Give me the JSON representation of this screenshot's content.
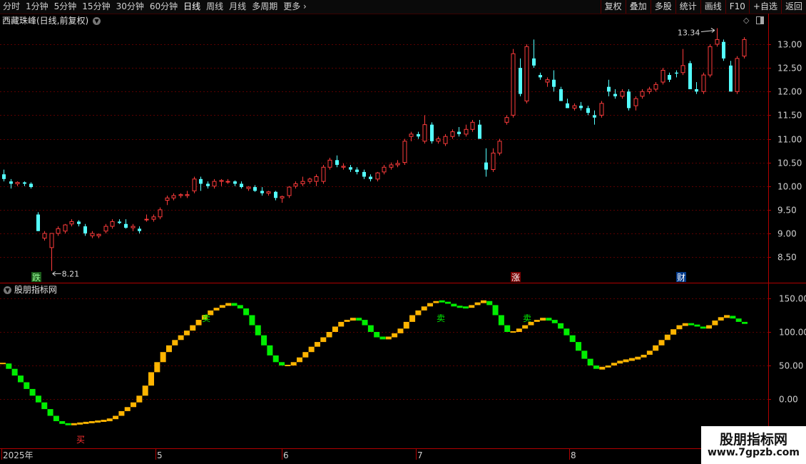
{
  "toolbar": {
    "periods": [
      "分时",
      "1分钟",
      "5分钟",
      "15分钟",
      "30分钟",
      "60分钟",
      "日线",
      "周线",
      "月线",
      "多周期",
      "更多"
    ],
    "active_period": "日线",
    "right_buttons": [
      "复权",
      "叠加",
      "多股",
      "统计",
      "画线",
      "F10",
      "+自选",
      "返回"
    ]
  },
  "main": {
    "title": "西藏珠峰(日线,前复权)",
    "y_ticks": [
      "13.00",
      "12.50",
      "12.00",
      "11.50",
      "11.00",
      "10.50",
      "10.00",
      "9.50",
      "9.00",
      "8.50"
    ],
    "high_label": "13.34",
    "low_label": "8.21",
    "events": [
      "跌",
      "涨",
      "财"
    ]
  },
  "indicator": {
    "title": "股朋指标网",
    "y_ticks": [
      "150.00",
      "100.00",
      "50.00",
      "0.00"
    ],
    "signals": [
      "买",
      "卖",
      "卖",
      "卖"
    ]
  },
  "x_axis": {
    "labels": [
      "2025年",
      "5",
      "6",
      "7",
      "8"
    ]
  },
  "watermark": {
    "title": "股朋指标网",
    "url": "www.7gpzb.com"
  },
  "colors": {
    "up": "#ff3b3b",
    "down": "#54ffff",
    "rise": "#ffb400",
    "fall": "#00ee00",
    "grid": "#5a0000",
    "axis": "#b00000"
  },
  "chart_data": [
    {
      "type": "candlestick",
      "title": "西藏珠峰(日线,前复权)",
      "ylim": [
        8.1,
        13.6
      ],
      "x": [
        1,
        2,
        3,
        4,
        5,
        6,
        7,
        8,
        9,
        10,
        11,
        12,
        13,
        14,
        15,
        16,
        17,
        18,
        19,
        20,
        21,
        22,
        23,
        24,
        25,
        26,
        27,
        28,
        29,
        30,
        31,
        32,
        33,
        34,
        35,
        36,
        37,
        38,
        39,
        40,
        41,
        42,
        43,
        44,
        45,
        46,
        47,
        48,
        49,
        50,
        51,
        52,
        53,
        54,
        55,
        56,
        57,
        58,
        59,
        60,
        61,
        62,
        63,
        64,
        65,
        66,
        67,
        68,
        69,
        70,
        71,
        72,
        73,
        74,
        75,
        76,
        77,
        78,
        79,
        80,
        81,
        82,
        83,
        84,
        85,
        86,
        87,
        88,
        89,
        90,
        91,
        92,
        93,
        94,
        95,
        96,
        97,
        98,
        99,
        100,
        101,
        102,
        103,
        104,
        105,
        106,
        107,
        108,
        109,
        110,
        111,
        112,
        113,
        114,
        115,
        116,
        117,
        118,
        119,
        120,
        121,
        122,
        123,
        124,
        125,
        126,
        127,
        128,
        129,
        130,
        131,
        132,
        133,
        134,
        135,
        136,
        137,
        138,
        139,
        140,
        141,
        142,
        143,
        144,
        145,
        146,
        147,
        148,
        149,
        150,
        151,
        152,
        153,
        154,
        155,
        156,
        157,
        158,
        159,
        160,
        161,
        162,
        163,
        164,
        165,
        166,
        167,
        168,
        169,
        170,
        171,
        172,
        173,
        174,
        175,
        176,
        177,
        178,
        179,
        180,
        181,
        182,
        183,
        184,
        185,
        186,
        187,
        188,
        189,
        190,
        191,
        192,
        193,
        194,
        195,
        196,
        197,
        198,
        199,
        200,
        201,
        202,
        203,
        204,
        205,
        206,
        207,
        208,
        209,
        210,
        211,
        212,
        213,
        214,
        215,
        216,
        217,
        218,
        219,
        220,
        221,
        222,
        223,
        224,
        225,
        226,
        227,
        228,
        229,
        230,
        231,
        232,
        233,
        234,
        235,
        236,
        237,
        238,
        239,
        240,
        241,
        242,
        243,
        244,
        245,
        246,
        247,
        248,
        249,
        250,
        251,
        252,
        253,
        254,
        255,
        256,
        257,
        258,
        259,
        260,
        261,
        262,
        263,
        264,
        265,
        266,
        267,
        268,
        269,
        270,
        271,
        272,
        273,
        274,
        275,
        276,
        277,
        278,
        279,
        280,
        281,
        282,
        283,
        284,
        285,
        286,
        287,
        288,
        289,
        290,
        291,
        292,
        293,
        294,
        295,
        296,
        297,
        298,
        299,
        300
      ],
      "candles": [
        [
          10.25,
          10.35,
          10.1,
          10.15
        ],
        [
          10.1,
          10.15,
          9.95,
          10.05
        ],
        [
          10.05,
          10.1,
          10.0,
          10.08
        ],
        [
          10.08,
          10.1,
          10.0,
          10.05
        ],
        [
          10.05,
          10.08,
          9.95,
          9.98
        ],
        [
          9.4,
          9.45,
          9.05,
          9.05
        ],
        [
          8.9,
          9.05,
          8.85,
          9.0
        ],
        [
          8.7,
          9.0,
          8.21,
          9.0
        ],
        [
          9.0,
          9.15,
          8.95,
          9.1
        ],
        [
          9.05,
          9.2,
          9.0,
          9.18
        ],
        [
          9.2,
          9.3,
          9.15,
          9.25
        ],
        [
          9.25,
          9.28,
          9.15,
          9.2
        ],
        [
          9.15,
          9.2,
          8.95,
          9.0
        ],
        [
          8.95,
          9.05,
          8.9,
          9.0
        ],
        [
          8.95,
          9.0,
          8.9,
          8.98
        ],
        [
          9.05,
          9.2,
          9.0,
          9.15
        ],
        [
          9.15,
          9.3,
          9.1,
          9.25
        ],
        [
          9.25,
          9.3,
          9.2,
          9.22
        ],
        [
          9.2,
          9.3,
          9.1,
          9.12
        ],
        [
          9.12,
          9.2,
          9.05,
          9.15
        ],
        [
          9.1,
          9.15,
          9.0,
          9.05
        ],
        [
          9.3,
          9.4,
          9.25,
          9.3
        ],
        [
          9.3,
          9.4,
          9.25,
          9.35
        ],
        [
          9.35,
          9.55,
          9.3,
          9.5
        ],
        [
          9.7,
          9.8,
          9.6,
          9.75
        ],
        [
          9.75,
          9.85,
          9.7,
          9.8
        ],
        [
          9.8,
          9.85,
          9.75,
          9.82
        ],
        [
          9.8,
          9.9,
          9.75,
          9.82
        ],
        [
          9.9,
          10.2,
          9.85,
          10.15
        ],
        [
          10.15,
          10.2,
          9.9,
          10.05
        ],
        [
          10.05,
          10.1,
          9.95,
          10.0
        ],
        [
          10.0,
          10.15,
          9.95,
          10.1
        ],
        [
          10.1,
          10.15,
          10.0,
          10.12
        ],
        [
          10.1,
          10.15,
          10.05,
          10.1
        ],
        [
          10.1,
          10.12,
          10.0,
          10.05
        ],
        [
          10.05,
          10.1,
          9.95,
          9.98
        ],
        [
          9.95,
          10.0,
          9.9,
          9.98
        ],
        [
          9.98,
          10.02,
          9.88,
          9.9
        ],
        [
          9.9,
          9.98,
          9.8,
          9.85
        ],
        [
          9.85,
          9.9,
          9.8,
          9.88
        ],
        [
          9.88,
          9.9,
          9.7,
          9.75
        ],
        [
          9.75,
          9.8,
          9.65,
          9.78
        ],
        [
          9.8,
          10.0,
          9.75,
          9.98
        ],
        [
          10.0,
          10.1,
          9.95,
          10.05
        ],
        [
          10.05,
          10.2,
          10.0,
          10.1
        ],
        [
          10.1,
          10.18,
          10.05,
          10.15
        ],
        [
          10.1,
          10.25,
          10.0,
          10.2
        ],
        [
          10.1,
          10.45,
          10.05,
          10.4
        ],
        [
          10.4,
          10.6,
          10.35,
          10.55
        ],
        [
          10.55,
          10.65,
          10.4,
          10.45
        ],
        [
          10.4,
          10.48,
          10.35,
          10.42
        ],
        [
          10.4,
          10.45,
          10.3,
          10.35
        ],
        [
          10.35,
          10.4,
          10.25,
          10.3
        ],
        [
          10.3,
          10.35,
          10.15,
          10.2
        ],
        [
          10.2,
          10.25,
          10.1,
          10.15
        ],
        [
          10.15,
          10.3,
          10.1,
          10.28
        ],
        [
          10.3,
          10.45,
          10.25,
          10.4
        ],
        [
          10.4,
          10.5,
          10.35,
          10.45
        ],
        [
          10.45,
          10.55,
          10.4,
          10.48
        ],
        [
          10.5,
          11.0,
          10.45,
          10.95
        ],
        [
          11.05,
          11.15,
          10.95,
          11.1
        ],
        [
          11.1,
          11.15,
          11.0,
          11.05
        ],
        [
          10.95,
          11.5,
          10.9,
          11.3
        ],
        [
          11.3,
          11.35,
          10.9,
          10.95
        ],
        [
          10.95,
          11.05,
          10.9,
          11.0
        ],
        [
          10.9,
          11.1,
          10.85,
          11.05
        ],
        [
          11.05,
          11.2,
          11.0,
          11.15
        ],
        [
          11.15,
          11.25,
          11.05,
          11.1
        ],
        [
          11.1,
          11.3,
          11.05,
          11.2
        ],
        [
          11.2,
          11.4,
          11.15,
          11.35
        ],
        [
          11.3,
          11.4,
          11.0,
          11.0
        ],
        [
          10.5,
          10.8,
          10.2,
          10.35
        ],
        [
          10.35,
          10.8,
          10.3,
          10.7
        ],
        [
          10.7,
          11.0,
          10.65,
          10.95
        ],
        [
          11.35,
          11.5,
          11.3,
          11.45
        ],
        [
          11.5,
          12.9,
          11.45,
          12.8
        ],
        [
          12.5,
          12.7,
          11.9,
          11.95
        ],
        [
          11.8,
          13.0,
          11.75,
          12.95
        ],
        [
          12.7,
          13.1,
          12.5,
          12.55
        ],
        [
          12.35,
          12.4,
          12.25,
          12.3
        ],
        [
          12.2,
          12.3,
          12.1,
          12.25
        ],
        [
          12.25,
          12.45,
          12.0,
          12.1
        ],
        [
          12.05,
          12.1,
          11.8,
          11.8
        ],
        [
          11.75,
          11.85,
          11.65,
          11.65
        ],
        [
          11.65,
          11.75,
          11.6,
          11.7
        ],
        [
          11.7,
          11.78,
          11.6,
          11.65
        ],
        [
          11.65,
          11.7,
          11.5,
          11.55
        ],
        [
          11.5,
          11.6,
          11.3,
          11.45
        ],
        [
          11.5,
          11.8,
          11.45,
          11.75
        ],
        [
          12.1,
          12.25,
          11.9,
          12.0
        ],
        [
          11.95,
          12.05,
          11.85,
          11.9
        ],
        [
          11.9,
          12.05,
          11.85,
          12.0
        ],
        [
          12.0,
          12.05,
          11.6,
          11.65
        ],
        [
          11.7,
          11.9,
          11.6,
          11.85
        ],
        [
          11.9,
          12.05,
          11.85,
          12.0
        ],
        [
          12.0,
          12.1,
          11.95,
          12.05
        ],
        [
          12.05,
          12.2,
          12.0,
          12.15
        ],
        [
          12.2,
          12.5,
          12.15,
          12.45
        ],
        [
          12.35,
          12.4,
          12.2,
          12.25
        ],
        [
          12.4,
          12.45,
          12.3,
          12.38
        ],
        [
          12.4,
          12.9,
          12.35,
          12.55
        ],
        [
          12.6,
          12.65,
          12.05,
          12.05
        ],
        [
          12.05,
          12.2,
          11.95,
          12.0
        ],
        [
          12.0,
          12.4,
          11.95,
          12.35
        ],
        [
          12.35,
          13.0,
          12.3,
          12.95
        ],
        [
          13.0,
          13.34,
          12.95,
          13.1
        ],
        [
          13.05,
          13.1,
          12.65,
          12.7
        ],
        [
          12.55,
          12.65,
          12.0,
          12.0
        ],
        [
          12.0,
          12.75,
          11.95,
          12.7
        ],
        [
          12.75,
          13.15,
          12.7,
          13.1
        ]
      ]
    },
    {
      "type": "bar",
      "title": "股朋指标网",
      "ylim": [
        -35,
        160
      ],
      "values": [
        53,
        45,
        35,
        25,
        15,
        5,
        -5,
        -15,
        -25,
        -33,
        -37,
        -38,
        -37,
        -36,
        -35,
        -34,
        -33,
        -32,
        -30,
        -25,
        -18,
        -12,
        -5,
        5,
        20,
        40,
        55,
        70,
        80,
        88,
        95,
        102,
        110,
        118,
        125,
        132,
        136,
        140,
        142,
        140,
        135,
        125,
        110,
        95,
        80,
        65,
        55,
        50,
        50,
        55,
        62,
        70,
        78,
        85,
        92,
        100,
        108,
        115,
        118,
        120,
        118,
        110,
        100,
        92,
        90,
        92,
        98,
        105,
        115,
        125,
        132,
        138,
        143,
        146,
        145,
        142,
        138,
        137,
        136,
        140,
        144,
        146,
        140,
        125,
        110,
        100,
        100,
        105,
        110,
        115,
        118,
        120,
        118,
        113,
        105,
        95,
        85,
        72,
        60,
        50,
        45,
        47,
        50,
        54,
        56,
        58,
        60,
        62,
        66,
        72,
        80,
        88,
        96,
        104,
        110,
        112,
        111,
        108,
        105,
        110,
        117,
        122,
        124,
        120,
        115,
        112
      ]
    }
  ]
}
